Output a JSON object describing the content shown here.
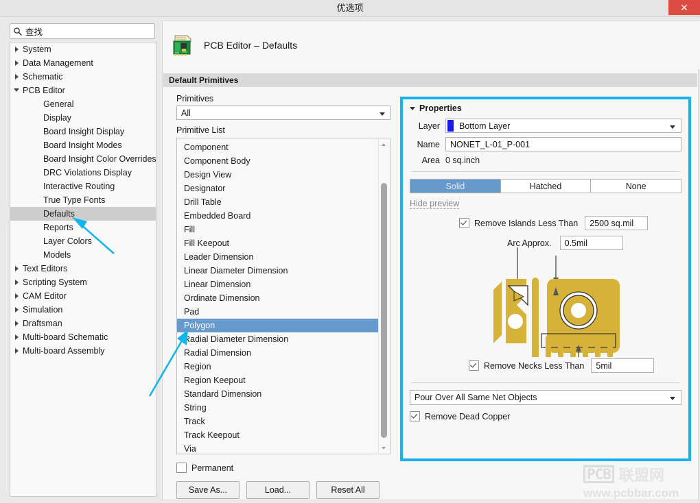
{
  "window": {
    "title": "优选项",
    "close_label": "✕",
    "close_icon": "close-icon"
  },
  "search": {
    "value": "查找",
    "icon": "search-icon"
  },
  "sidebar": {
    "items": [
      {
        "label": "System",
        "level": 0,
        "state": "collapsed",
        "selected": false
      },
      {
        "label": "Data Management",
        "level": 0,
        "state": "collapsed",
        "selected": false
      },
      {
        "label": "Schematic",
        "level": 0,
        "state": "collapsed",
        "selected": false
      },
      {
        "label": "PCB Editor",
        "level": 0,
        "state": "expanded",
        "selected": false
      },
      {
        "label": "General",
        "level": 1,
        "state": "leaf",
        "selected": false
      },
      {
        "label": "Display",
        "level": 1,
        "state": "leaf",
        "selected": false
      },
      {
        "label": "Board Insight Display",
        "level": 1,
        "state": "leaf",
        "selected": false
      },
      {
        "label": "Board Insight Modes",
        "level": 1,
        "state": "leaf",
        "selected": false
      },
      {
        "label": "Board Insight Color Overrides",
        "level": 1,
        "state": "leaf",
        "selected": false
      },
      {
        "label": "DRC Violations Display",
        "level": 1,
        "state": "leaf",
        "selected": false
      },
      {
        "label": "Interactive Routing",
        "level": 1,
        "state": "leaf",
        "selected": false
      },
      {
        "label": "True Type Fonts",
        "level": 1,
        "state": "leaf",
        "selected": false
      },
      {
        "label": "Defaults",
        "level": 1,
        "state": "leaf",
        "selected": true
      },
      {
        "label": "Reports",
        "level": 1,
        "state": "leaf",
        "selected": false
      },
      {
        "label": "Layer Colors",
        "level": 1,
        "state": "leaf",
        "selected": false
      },
      {
        "label": "Models",
        "level": 1,
        "state": "leaf",
        "selected": false
      },
      {
        "label": "Text Editors",
        "level": 0,
        "state": "collapsed",
        "selected": false
      },
      {
        "label": "Scripting System",
        "level": 0,
        "state": "collapsed",
        "selected": false
      },
      {
        "label": "CAM Editor",
        "level": 0,
        "state": "collapsed",
        "selected": false
      },
      {
        "label": "Simulation",
        "level": 0,
        "state": "collapsed",
        "selected": false
      },
      {
        "label": "Draftsman",
        "level": 0,
        "state": "collapsed",
        "selected": false
      },
      {
        "label": "Multi-board Schematic",
        "level": 0,
        "state": "collapsed",
        "selected": false
      },
      {
        "label": "Multi-board Assembly",
        "level": 0,
        "state": "collapsed",
        "selected": false
      }
    ]
  },
  "page": {
    "icon": "pcb-board-icon",
    "title": "PCB Editor – Defaults",
    "section_title": "Default Primitives"
  },
  "primitives": {
    "filter_label": "Primitives",
    "filter_value": "All",
    "list_label": "Primitive List",
    "items": [
      "Component",
      "Component Body",
      "Design View",
      "Designator",
      "Drill Table",
      "Embedded Board",
      "Fill",
      "Fill Keepout",
      "Leader Dimension",
      "Linear Diameter Dimension",
      "Linear Dimension",
      "Ordinate Dimension",
      "Pad",
      "Polygon",
      "Radial Diameter Dimension",
      "Radial Dimension",
      "Region",
      "Region Keepout",
      "Standard Dimension",
      "String",
      "Track",
      "Track Keepout",
      "Via"
    ],
    "selected": "Polygon"
  },
  "footer": {
    "permanent_label": "Permanent",
    "permanent_checked": false,
    "buttons": [
      {
        "label": "Save As..."
      },
      {
        "label": "Load..."
      },
      {
        "label": "Reset All"
      }
    ]
  },
  "properties": {
    "heading": "Properties",
    "highlight_color": "#13b5ea",
    "layer_label": "Layer",
    "layer_value": "Bottom Layer",
    "layer_swatch_color": "#1a1ae6",
    "name_label": "Name",
    "name_value": "NONET_L-01_P-001",
    "area_label": "Area",
    "area_value": "0 sq.inch",
    "fill_modes": [
      {
        "label": "Solid",
        "active": true
      },
      {
        "label": "Hatched",
        "active": false
      },
      {
        "label": "None",
        "active": false
      }
    ],
    "hide_preview_label": "Hide preview",
    "remove_islands": {
      "label": "Remove Islands Less Than",
      "checked": true,
      "value": "2500 sq.mil"
    },
    "arc_approx": {
      "label": "Arc Approx.",
      "value": "0.5mil"
    },
    "remove_necks": {
      "label": "Remove Necks Less Than",
      "checked": true,
      "value": "5mil"
    },
    "pour_over_value": "Pour Over All Same Net Objects",
    "remove_dead_copper": {
      "label": "Remove Dead Copper",
      "checked": true
    },
    "preview_fill_color": "#d7b239"
  },
  "watermark": {
    "logo_text": "PCB",
    "cn_text": "联盟网",
    "url_text": "www.pcbbar.com"
  }
}
